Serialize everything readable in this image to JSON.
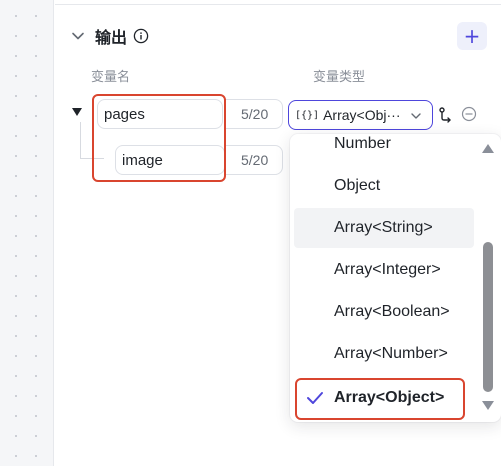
{
  "section": {
    "title": "输出",
    "info_icon": "info-icon",
    "add_label": "+"
  },
  "columns": {
    "name_header": "变量名",
    "type_header": "变量类型"
  },
  "rows": [
    {
      "name": "pages",
      "count": "5/20"
    },
    {
      "name": "image",
      "count": "5/20"
    }
  ],
  "type_select": {
    "icon": "[{}]",
    "value": "Array<Obj···"
  },
  "dropdown": {
    "options": [
      "Number",
      "Object",
      "Array<String>",
      "Array<Integer>",
      "Array<Boolean>",
      "Array<Number>",
      "Array<Object>"
    ],
    "selected": "Array<Object>",
    "hovered": "Array<String>"
  },
  "colors": {
    "accent": "#4e46dc",
    "highlight": "#d9452f"
  }
}
